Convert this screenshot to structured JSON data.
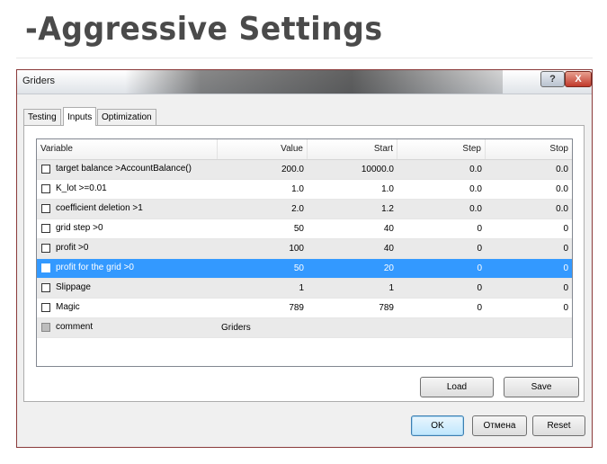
{
  "slide": {
    "title": "-Aggressive Settings"
  },
  "window": {
    "title": "Griders",
    "help_label": "?",
    "close_label": "X"
  },
  "tabs": [
    {
      "label": "Testing"
    },
    {
      "label": "Inputs"
    },
    {
      "label": "Optimization"
    }
  ],
  "table": {
    "columns": [
      "Variable",
      "Value",
      "Start",
      "Step",
      "Stop"
    ],
    "rows": [
      {
        "variable": "target balance >AccountBalance()",
        "value": "200.0",
        "start": "10000.0",
        "step": "0.0",
        "stop": "0.0",
        "checked": false
      },
      {
        "variable": "K_lot >=0.01",
        "value": "1.0",
        "start": "1.0",
        "step": "0.0",
        "stop": "0.0",
        "checked": false
      },
      {
        "variable": "coefficient deletion >1",
        "value": "2.0",
        "start": "1.2",
        "step": "0.0",
        "stop": "0.0",
        "checked": false
      },
      {
        "variable": "grid step >0",
        "value": "50",
        "start": "40",
        "step": "0",
        "stop": "0",
        "checked": false
      },
      {
        "variable": "profit >0",
        "value": "100",
        "start": "40",
        "step": "0",
        "stop": "0",
        "checked": false
      },
      {
        "variable": "profit for the grid >0",
        "value": "50",
        "start": "20",
        "step": "0",
        "stop": "0",
        "checked": false,
        "selected": true
      },
      {
        "variable": "Slippage",
        "value": "1",
        "start": "1",
        "step": "0",
        "stop": "0",
        "checked": false
      },
      {
        "variable": "Magic",
        "value": "789",
        "start": "789",
        "step": "0",
        "stop": "0",
        "checked": false
      },
      {
        "variable": "comment",
        "value": "Griders",
        "start": "",
        "step": "",
        "stop": "",
        "checked": false,
        "disabled": true
      }
    ]
  },
  "buttons": {
    "load": "Load",
    "save": "Save",
    "ok": "OK",
    "cancel": "Отмена",
    "reset": "Reset"
  },
  "colors": {
    "selection": "#3399ff",
    "window_border": "#8a3a3a",
    "title_text": "#4a4a4a"
  }
}
